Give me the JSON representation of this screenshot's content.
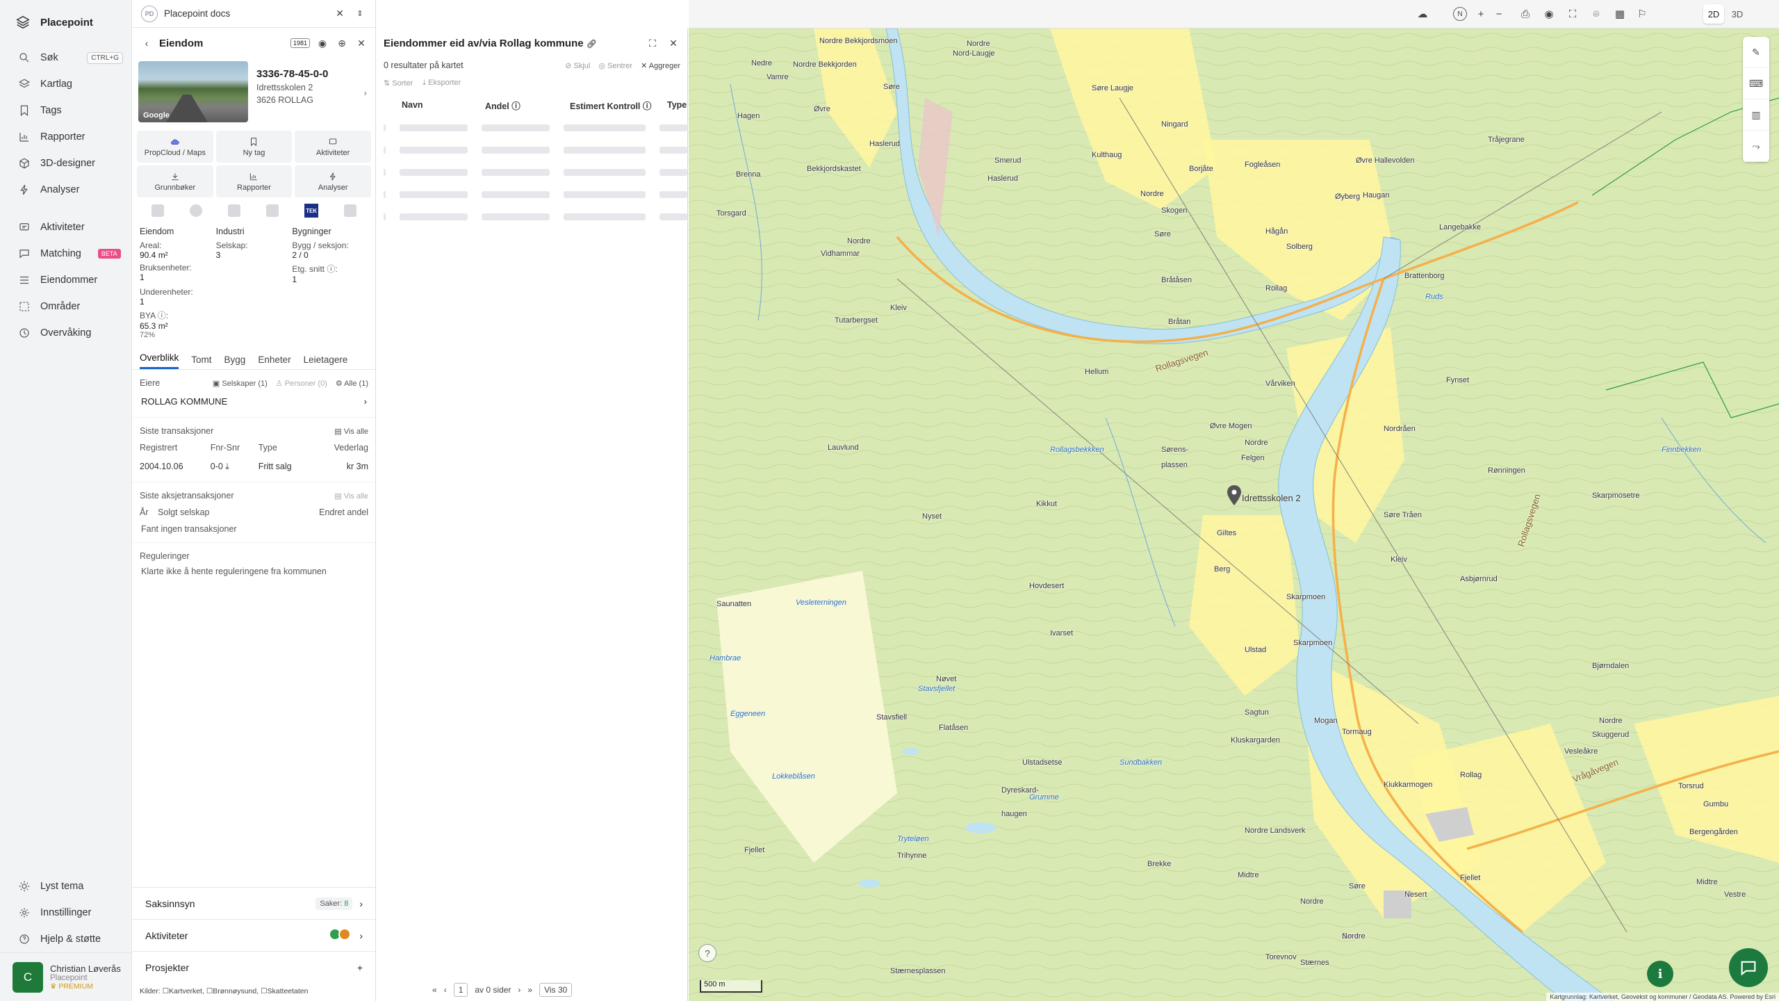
{
  "app": {
    "name": "Placepoint"
  },
  "nav": {
    "items": [
      {
        "label": "Søk",
        "shortcut": "CTRL+G"
      },
      {
        "label": "Kartlag"
      },
      {
        "label": "Tags"
      },
      {
        "label": "Rapporter"
      },
      {
        "label": "3D-designer"
      },
      {
        "label": "Analyser"
      }
    ],
    "items2": [
      {
        "label": "Aktiviteter"
      },
      {
        "label": "Matching",
        "badge": "BETA"
      },
      {
        "label": "Eiendommer"
      },
      {
        "label": "Områder"
      },
      {
        "label": "Overvåking"
      }
    ],
    "bottom": [
      {
        "label": "Lyst tema"
      },
      {
        "label": "Innstillinger"
      },
      {
        "label": "Hjelp & støtte"
      }
    ],
    "user": {
      "initial": "C",
      "name": "Christian Løverås",
      "org": "Placepoint",
      "plan": "PREMIUM"
    }
  },
  "doc_tab": {
    "badge": "PD",
    "title": "Placepoint docs"
  },
  "property": {
    "header": "Eiendom",
    "badge": "1981",
    "id": "3336-78-45-0-0",
    "street": "Idrettsskolen 2",
    "postal": "3626 ROLLAG",
    "photo_credit": "Google",
    "buttons": [
      "PropCloud / Maps",
      "Ny tag",
      "Aktiviteter",
      "Grunnbøker",
      "Rapporter",
      "Analyser"
    ],
    "tek_label": "TEK",
    "facts": {
      "col1_head": "Eiendom",
      "col2_head": "Industri",
      "col3_head": "Bygninger",
      "areal_k": "Areal:",
      "areal_v": "90.4 m²",
      "selskap_k": "Selskap:",
      "selskap_v": "3",
      "bygg_k": "Bygg / seksjon:",
      "bygg_v": "2 / 0",
      "bruks_k": "Bruksenheter:",
      "bruks_v": "1",
      "etg_k": "Etg. snitt ⓘ:",
      "etg_v": "1",
      "under_k": "Underenheter:",
      "under_v": "1",
      "bya_k": "BYA ⓘ:",
      "bya_v": "65.3 m²",
      "bya_pct": "72%"
    },
    "tabs": [
      "Overblikk",
      "Tomt",
      "Bygg",
      "Enheter",
      "Leietagere"
    ],
    "owners": {
      "title": "Eiere",
      "companies": "Selskaper (1)",
      "persons": "Personer (0)",
      "all": "Alle (1)",
      "name": "ROLLAG KOMMUNE"
    },
    "transactions": {
      "title": "Siste transaksjoner",
      "show_all": "Vis alle",
      "headers": [
        "Registrert",
        "Fnr-Snr",
        "Type",
        "Vederlag"
      ],
      "rows": [
        [
          "2004.10.06",
          "0-0 ⤓",
          "Fritt salg",
          "kr 3m"
        ]
      ]
    },
    "share_tx": {
      "title": "Siste aksjetransaksjoner",
      "show_all": "Vis alle",
      "headers": [
        "År",
        "Solgt selskap",
        "Endret andel"
      ],
      "empty": "Fant ingen transaksjoner"
    },
    "regulations": {
      "title": "Reguleringer",
      "note": "Klarte ikke å hente reguleringene fra kommunen"
    },
    "sections": {
      "saksinnsyn": "Saksinnsyn",
      "saker_label": "Saker:",
      "saker_count": "8",
      "aktiviteter": "Aktiviteter",
      "prosjekter": "Prosjekter"
    },
    "sources_label": "Kilder:",
    "sources": [
      "Kartverket",
      "Brønnøysund",
      "Skatteetaten"
    ]
  },
  "results": {
    "title": "Eiendommer eid av/via Rollag kommune",
    "count": "0 resultater på kartet",
    "actions": [
      "Skjul",
      "Sentrer",
      "Aggreger"
    ],
    "tools": [
      "Sorter",
      "Eksporter"
    ],
    "columns": [
      "Navn",
      "Andel ⓘ",
      "Estimert Kontroll ⓘ",
      "Type"
    ],
    "pager": {
      "page": "1",
      "of": "av 0 sider",
      "per_page": "Vis 30"
    }
  },
  "map": {
    "view_2d": "2D",
    "view_3d": "3D",
    "marker_label": "Idrettsskolen 2",
    "scale": "500 m",
    "attribution": "Kartgrunnlag: Kartverket, Geovekst og kommuner / Geodata AS. Powered by Esri",
    "places": [
      {
        "t": "Nordre Bekkjordsmoen"
      },
      {
        "t": "Nordre"
      },
      {
        "t": "Nord-Laugje"
      },
      {
        "t": "Vamre"
      },
      {
        "t": "Nedre"
      },
      {
        "t": "Nordre Bekkjorden"
      },
      {
        "t": "Søre"
      },
      {
        "t": "Søre Laugje"
      },
      {
        "t": "Øvre"
      },
      {
        "t": "Hagen"
      },
      {
        "t": "Haslerud"
      },
      {
        "t": "Kulthaug"
      },
      {
        "t": "Smerud"
      },
      {
        "t": "Bekkjordskastet"
      },
      {
        "t": "Brenna"
      },
      {
        "t": "Haslerud"
      },
      {
        "t": "Torsgard"
      },
      {
        "t": "Nordre"
      },
      {
        "t": "Vidhammar"
      },
      {
        "t": "Tutarbergset"
      },
      {
        "t": "Kleiv"
      },
      {
        "t": "Ningard"
      },
      {
        "t": "Øvre Hallevolden"
      },
      {
        "t": "Fogleåsen"
      },
      {
        "t": "Borjåte"
      },
      {
        "t": "Nordre"
      },
      {
        "t": "Skogen"
      },
      {
        "t": "Søre"
      },
      {
        "t": "Hågån"
      },
      {
        "t": "Solberg"
      },
      {
        "t": "Øyberg"
      },
      {
        "t": "Haugan"
      },
      {
        "t": "Langebakke"
      },
      {
        "t": "Tråjegrane"
      },
      {
        "t": "Bråtåsen"
      },
      {
        "t": "Rollag"
      },
      {
        "t": "Brattenborg"
      },
      {
        "t": "Bråtan"
      },
      {
        "t": "Hellum"
      },
      {
        "t": "Vårviken"
      },
      {
        "t": "Øvre Mogen"
      },
      {
        "t": "Nordre"
      },
      {
        "t": "Nordråen"
      },
      {
        "t": "Fynset"
      },
      {
        "t": "Sørens-"
      },
      {
        "t": "plassen"
      },
      {
        "t": "Felgen"
      },
      {
        "t": "Lauvlund"
      },
      {
        "t": "Rønningen"
      },
      {
        "t": "Skarpmosetre"
      },
      {
        "t": "Kikkut"
      },
      {
        "t": "Nyset"
      },
      {
        "t": "Giltes"
      },
      {
        "t": "Søre Tråen"
      },
      {
        "t": "Kleiv"
      },
      {
        "t": "Berg"
      },
      {
        "t": "Asbjørnrud"
      },
      {
        "t": "Hovdesert"
      },
      {
        "t": "Saunatten"
      },
      {
        "t": "Skarpmoen"
      },
      {
        "t": "Ivarset"
      },
      {
        "t": "Skarpmoen"
      },
      {
        "t": "Ulstad"
      },
      {
        "t": "Nøvet"
      },
      {
        "t": "Bjørndalen"
      },
      {
        "t": "Stavsfiell"
      },
      {
        "t": "Flatåsen"
      },
      {
        "t": "Sagtun"
      },
      {
        "t": "Mogan"
      },
      {
        "t": "Nordre"
      },
      {
        "t": "Skuggerud"
      },
      {
        "t": "Tormaug"
      },
      {
        "t": "Ulstadsetse"
      },
      {
        "t": "Kluskargarden"
      },
      {
        "t": "Vesleåkre"
      },
      {
        "t": "Rollag"
      },
      {
        "t": "Kiukkarmogen"
      },
      {
        "t": "Torsrud"
      },
      {
        "t": "Gumbu"
      },
      {
        "t": "Bergengården"
      },
      {
        "t": "Fjellet"
      },
      {
        "t": "Dyreskard-"
      },
      {
        "t": "haugen"
      },
      {
        "t": "Nordre Landsverk"
      },
      {
        "t": "Trihynne"
      },
      {
        "t": "Brekke"
      },
      {
        "t": "Midtre"
      },
      {
        "t": "Søre"
      },
      {
        "t": "Nordre"
      },
      {
        "t": "Nesert"
      },
      {
        "t": "Søre"
      },
      {
        "t": "Fjellet"
      },
      {
        "t": "Stærnesplassen"
      },
      {
        "t": "Torevnov"
      },
      {
        "t": "Nordre"
      },
      {
        "t": "Stærnes"
      },
      {
        "t": "Midtre"
      },
      {
        "t": "Vestre"
      }
    ],
    "water_labels": [
      {
        "t": "Vesleterningen"
      },
      {
        "t": "Grumme"
      },
      {
        "t": "Stavsfjellet"
      },
      {
        "t": "Sundbakken"
      },
      {
        "t": "Tryteløen"
      },
      {
        "t": "Lokkeblåsen"
      },
      {
        "t": "Eggeneen"
      },
      {
        "t": "Ruds"
      },
      {
        "t": "Rollagsbekkken"
      },
      {
        "t": "Finnbekken"
      },
      {
        "t": "Hambrae"
      }
    ],
    "roads": [
      {
        "t": "Rollagsvegen"
      },
      {
        "t": "Rollagsvegen"
      },
      {
        "t": "Vrågåvegen"
      }
    ]
  },
  "colors": {
    "accent": "#1a64c8",
    "brand_green": "#1c7a3f",
    "map_green": "#dbeab7",
    "map_yellow": "#fff59a",
    "water": "#c7e8f6"
  }
}
